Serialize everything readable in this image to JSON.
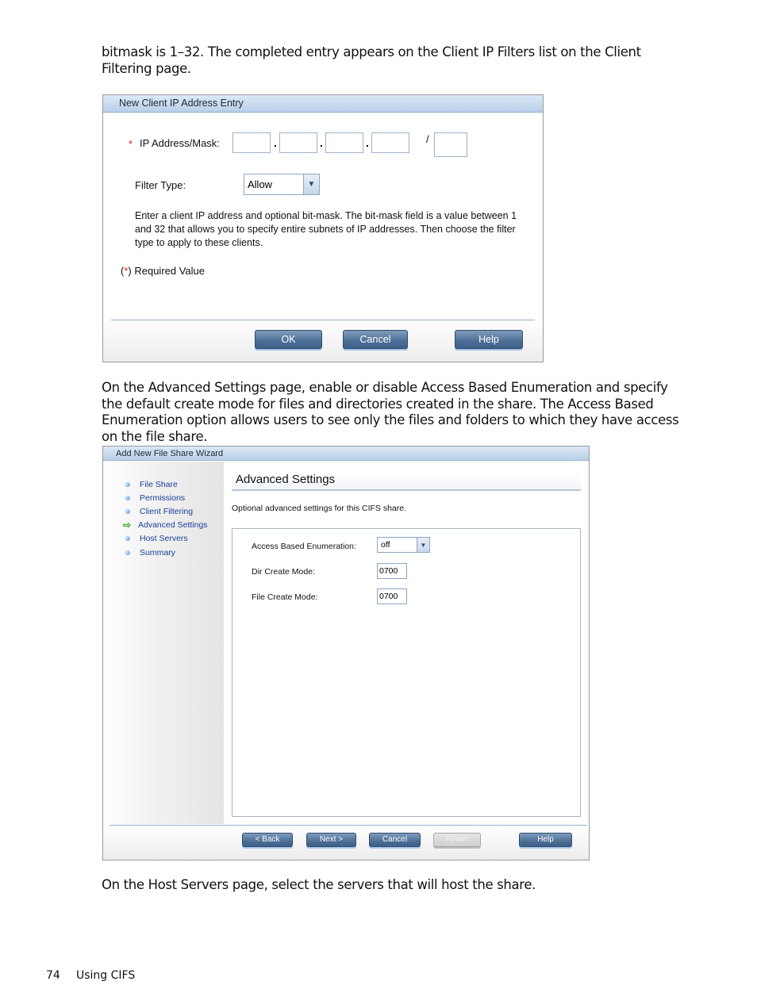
{
  "paragraphs": {
    "intro": "bitmask is 1–32. The completed entry appears on the Client IP Filters list on the Client Filtering page.",
    "advanced": "On the Advanced Settings page, enable or disable Access Based Enumeration and specify the default create mode for files and directories created in the share. The Access Based Enumeration option allows users to see only the files and folders to which they have access on the file share.",
    "host_servers": "On the Host Servers page, select the servers that will host the share."
  },
  "ip_dialog": {
    "title": "New Client IP Address Entry",
    "ip_label": "IP Address/Mask:",
    "required_marker": "*",
    "ip_octets": [
      "",
      "",
      "",
      ""
    ],
    "octet_separator": ".",
    "mask_separator": "/",
    "mask": "",
    "filter_type_label": "Filter Type:",
    "filter_type_value": "Allow",
    "help_text": "Enter a client IP address and optional bit-mask. The bit-mask field is a value between 1 and 32 that allows you to specify entire subnets of IP addresses. Then choose the filter type to apply to these clients.",
    "required_note_open": "(",
    "required_note_close": ") Required Value",
    "buttons": {
      "ok": "OK",
      "cancel": "Cancel",
      "help": "Help"
    }
  },
  "wizard": {
    "title": "Add New File Share Wizard",
    "steps": [
      {
        "label": "File Share",
        "icon": "bullet-icon",
        "current": false
      },
      {
        "label": "Permissions",
        "icon": "bullet-icon",
        "current": false
      },
      {
        "label": "Client Filtering",
        "icon": "bullet-icon",
        "current": false
      },
      {
        "label": "Advanced Settings",
        "icon": "arrow-right-icon",
        "current": true
      },
      {
        "label": "Host Servers",
        "icon": "bullet-icon",
        "current": false
      },
      {
        "label": "Summary",
        "icon": "bullet-icon",
        "current": false
      }
    ],
    "page_title": "Advanced Settings",
    "description": "Optional advanced settings for this CIFS share.",
    "fields": {
      "abe_label": "Access Based Enumeration:",
      "abe_value": "off",
      "dir_mode_label": "Dir Create Mode:",
      "dir_mode_value": "0700",
      "file_mode_label": "File Create Mode:",
      "file_mode_value": "0700"
    },
    "buttons": {
      "back": "< Back",
      "next": "Next >",
      "cancel": "Cancel",
      "finish": "Finish",
      "help": "Help"
    }
  },
  "footer": {
    "page_number": "74",
    "section": "Using CIFS"
  },
  "colors": {
    "button_blue": "#4d6f96",
    "title_bar": "#b9cfe8",
    "required_red": "#e02020",
    "link_blue": "#1a3d9c",
    "current_arrow": "#3fa52a"
  }
}
